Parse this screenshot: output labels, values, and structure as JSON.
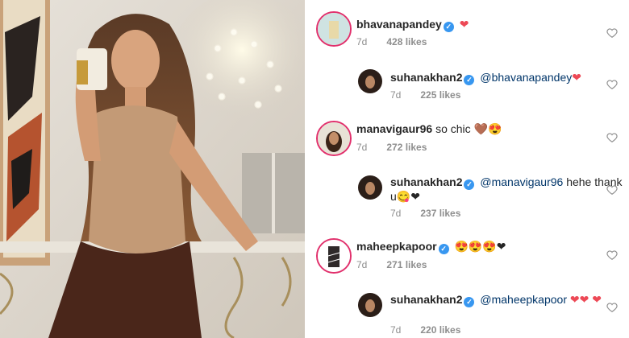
{
  "comments": [
    {
      "user": "bhavanapandey",
      "text": "❤",
      "time": "7d",
      "likes": "428 likes",
      "reply": false
    },
    {
      "user": "suhanakhan2",
      "mention": "@bhavanapandey",
      "text": "❤",
      "time": "7d",
      "likes": "225 likes",
      "reply": true
    },
    {
      "user": "manavigaur96",
      "text": "so chic 🤎😍",
      "time": "7d",
      "likes": "272 likes",
      "reply": false
    },
    {
      "user": "suhanakhan2",
      "mention": "@manavigaur96",
      "text": "hehe thank u😋❤",
      "time": "7d",
      "likes": "237 likes",
      "reply": true
    },
    {
      "user": "maheepkapoor",
      "text": "😍😍😍❤",
      "time": "7d",
      "likes": "271 likes",
      "reply": false
    },
    {
      "user": "suhanakhan2",
      "mention": "@maheepkapoor",
      "text": "❤❤ ❤",
      "time": "7d",
      "likes": "220 likes",
      "reply": true
    }
  ],
  "colors": {
    "verified": "#3897f0",
    "heart": "#ed4956",
    "mention": "#003569",
    "meta": "#8e8e8e"
  },
  "icons": {
    "verified": "verified-badge-icon",
    "like": "heart-outline-icon"
  }
}
